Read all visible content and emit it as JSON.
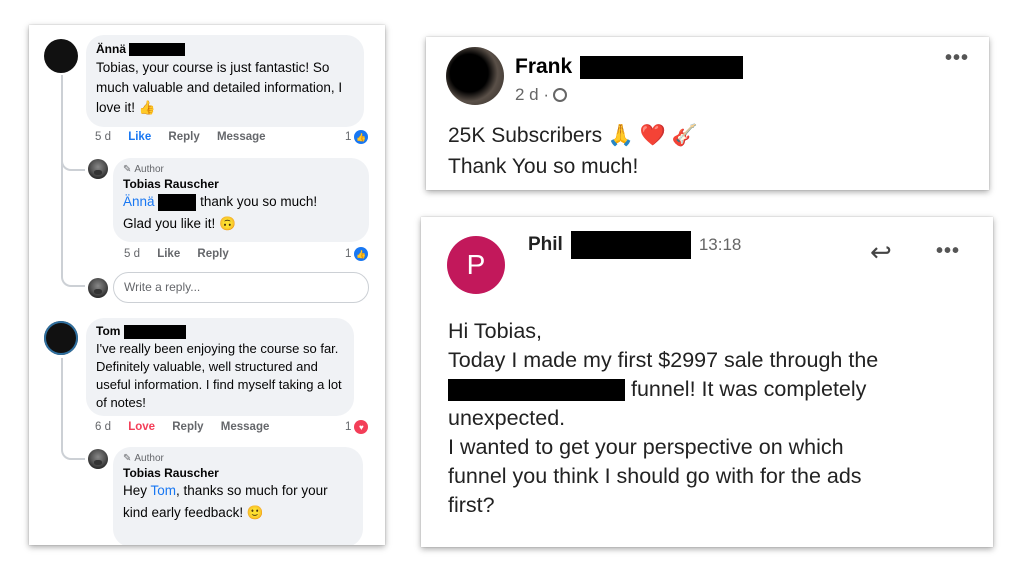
{
  "fb": {
    "c1": {
      "name": "Ännä",
      "text": "Tobias, your course is just fantastic! So much valuable and detailed information, I love it! 👍",
      "time": "5 d",
      "like": "Like",
      "reply": "Reply",
      "message": "Message",
      "count": "1"
    },
    "r1": {
      "author_label": "Author",
      "name": "Tobias Rauscher",
      "mention": "Ännä",
      "text_after": "thank you so much!",
      "text2": "Glad you like it! 🙃",
      "time": "5 d",
      "like": "Like",
      "reply": "Reply",
      "count": "1"
    },
    "write_reply": "Write a reply...",
    "c2": {
      "name": "Tom",
      "text": "I've really been enjoying the course so far. Definitely valuable, well structured and useful information. I find myself taking a lot of notes!",
      "time": "6 d",
      "love": "Love",
      "reply": "Reply",
      "message": "Message",
      "count": "1"
    },
    "r2": {
      "author_label": "Author",
      "name": "Tobias Rauscher",
      "hey": "Hey",
      "mention": "Tom",
      "text_after": ", thanks so much for your",
      "text2": "kind early feedback! 🙂"
    }
  },
  "frank": {
    "name": "Frank",
    "meta": "2 d ·",
    "line1": "25K Subscribers 🙏 ❤️ 🎸",
    "line2": "Thank You so much!"
  },
  "phil": {
    "avatar_letter": "P",
    "name": "Phil",
    "time": "13:18",
    "greeting": "Hi Tobias,",
    "line1": "Today I made my first $2997 sale through the",
    "line2_after": "funnel!  It was completely",
    "line3": "unexpected.",
    "line4": "I wanted to get your perspective on which",
    "line5": "funnel you think I should go with for the ads",
    "line6": "first?"
  },
  "colors": {
    "fb_blue": "#1877f2",
    "love_red": "#f33e58",
    "phil_avatar": "#c2185b"
  },
  "icons": [
    "like-reaction-icon",
    "love-reaction-icon",
    "pencil-icon",
    "globe-icon",
    "reply-arrow-icon",
    "more-dots-icon"
  ]
}
